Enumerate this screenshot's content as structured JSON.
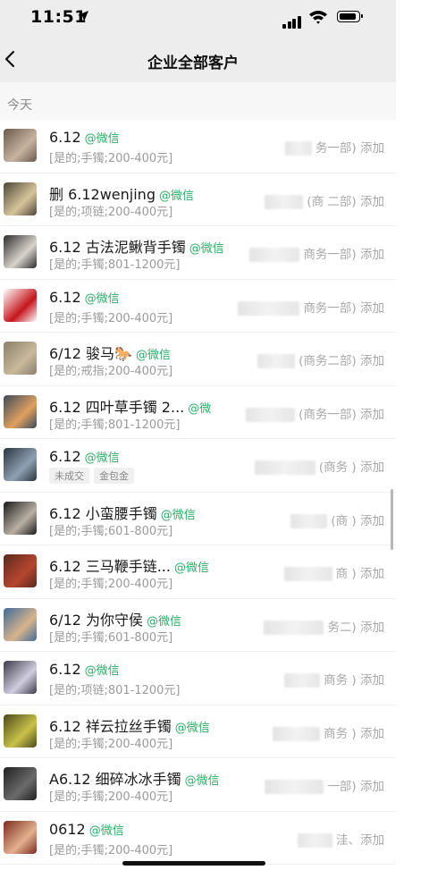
{
  "status": {
    "time": "11:51"
  },
  "nav": {
    "title": "企业全部客户"
  },
  "section": "今天",
  "rows": [
    {
      "name": "6.12",
      "tag": "@微信",
      "info": "[是的;手镯;200-400元]",
      "side": "务一部) 添加",
      "avatar": [
        "#6b5a4a",
        "#c7b3a0"
      ]
    },
    {
      "name": "删 6.12wenjing",
      "tag": "@微信",
      "info": "[是的;项链;200-400元]",
      "side": "(商 二部) 添加",
      "avatar": [
        "#4c4638",
        "#d8c49a"
      ]
    },
    {
      "name": "6.12 古法泥鳅背手镯",
      "tag": "@微信",
      "info": "[是的;手镯;801-1200元]",
      "side": "商务一部) 添加",
      "avatar": [
        "#2c2c2c",
        "#d9d3cc"
      ]
    },
    {
      "name": "6.12",
      "tag": "@微信",
      "info": "[是的;手镯;200-400元]",
      "side": "商务一部) 添加",
      "avatar": [
        "#ffffff",
        "#c4161c"
      ]
    },
    {
      "name": "6/12 骏马🐎",
      "tag": "@微信",
      "info": "[是的;戒指;200-400元]",
      "side": "(商务二部) 添加",
      "avatar": [
        "#8a7f6a",
        "#c9b99b"
      ]
    },
    {
      "name": "6.12 四叶草手镯 2...",
      "tag": "@微",
      "info": "[是的;手镯;801-1200元]",
      "side": "(商务一部) 添加",
      "avatar": [
        "#3a4a5a",
        "#e0a060"
      ]
    },
    {
      "name": "6.12",
      "tag": "@微信",
      "info": "",
      "chips": [
        "未成交",
        "金包金"
      ],
      "side": "(商务 ) 添加",
      "avatar": [
        "#2a3440",
        "#8ea0b2"
      ]
    },
    {
      "name": "6.12 小蛮腰手镯",
      "tag": "@微信",
      "info": "[是的;手镯;601-800元]",
      "side": "(商 ) 添加",
      "avatar": [
        "#1a1a1a",
        "#b9b0a4"
      ]
    },
    {
      "name": "6.12 三马鞭手链...",
      "tag": "@微信",
      "info": "[是的;手镯;200-400元]",
      "side": "商 ) 添加",
      "avatar": [
        "#5a2a1c",
        "#b5462e"
      ]
    },
    {
      "name": "6/12 为你守侯",
      "tag": "@微信",
      "info": "[是的;手镯;601-800元]",
      "side": "务二) 添加",
      "avatar": [
        "#3f6b9a",
        "#d8b48c"
      ]
    },
    {
      "name": "6.12",
      "tag": "@微信",
      "info": "[是的;项链;801-1200元]",
      "side": "商务 ) 添加",
      "avatar": [
        "#3c3a4a",
        "#d0cde0"
      ]
    },
    {
      "name": "6.12 祥云拉丝手镯",
      "tag": "@微信",
      "info": "[是的;手镯;200-400元]",
      "side": "商务 ) 添加",
      "avatar": [
        "#4a4a1a",
        "#c9c14a"
      ]
    },
    {
      "name": "A6.12 细碎冰冰手镯",
      "tag": "@微信",
      "info": "[是的;手镯;200-400元]",
      "side": "一部) 添加",
      "avatar": [
        "#202020",
        "#6b6b6b"
      ]
    },
    {
      "name": "0612",
      "tag": "@微信",
      "info": "[是的;手镯;200-400元]",
      "side": "洼、添加",
      "avatar": [
        "#7a2b1e",
        "#e3b08e"
      ]
    }
  ]
}
